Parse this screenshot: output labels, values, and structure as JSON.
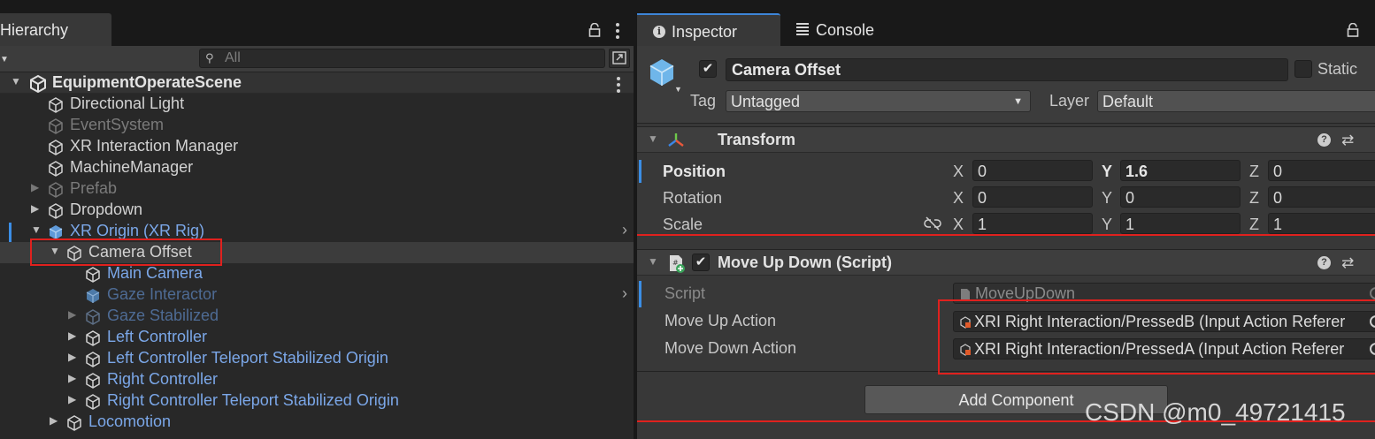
{
  "hierarchy": {
    "tab_label": "Hierarchy",
    "search_placeholder": "All",
    "scene": "EquipmentOperateScene",
    "items": [
      {
        "label": "Directional Light"
      },
      {
        "label": "EventSystem"
      },
      {
        "label": "XR Interaction Manager"
      },
      {
        "label": "MachineManager"
      },
      {
        "label": "Prefab"
      },
      {
        "label": "Dropdown"
      },
      {
        "label": "XR Origin (XR Rig)"
      },
      {
        "label": "Camera Offset"
      },
      {
        "label": "Main Camera"
      },
      {
        "label": "Gaze Interactor"
      },
      {
        "label": "Gaze Stabilized"
      },
      {
        "label": "Left Controller"
      },
      {
        "label": "Left Controller Teleport Stabilized Origin"
      },
      {
        "label": "Right Controller"
      },
      {
        "label": "Right Controller Teleport Stabilized Origin"
      },
      {
        "label": "Locomotion"
      }
    ]
  },
  "inspector": {
    "tabs": {
      "inspector": "Inspector",
      "console": "Console"
    },
    "object_name": "Camera Offset",
    "static_label": "Static",
    "tag_label": "Tag",
    "tag_value": "Untagged",
    "layer_label": "Layer",
    "layer_value": "Default",
    "transform": {
      "title": "Transform",
      "position_label": "Position",
      "rotation_label": "Rotation",
      "scale_label": "Scale",
      "axis_x": "X",
      "axis_y": "Y",
      "axis_z": "Z",
      "position": {
        "x": "0",
        "y": "1.6",
        "z": "0"
      },
      "rotation": {
        "x": "0",
        "y": "0",
        "z": "0"
      },
      "scale": {
        "x": "1",
        "y": "1",
        "z": "1"
      }
    },
    "script_component": {
      "title": "Move Up Down (Script)",
      "script_label": "Script",
      "script_value": "MoveUpDown",
      "move_up_label": "Move Up Action",
      "move_up_value": "XRI Right Interaction/PressedB (Input Action Referer",
      "move_down_label": "Move Down Action",
      "move_down_value": "XRI Right Interaction/PressedA (Input Action Referer"
    },
    "add_component": "Add Component"
  },
  "watermark": "CSDN @m0_49721415",
  "colors": {
    "accent": "#3b8ee6",
    "highlight_box": "#e0211e",
    "prefab_blue": "#7ba7e8"
  }
}
